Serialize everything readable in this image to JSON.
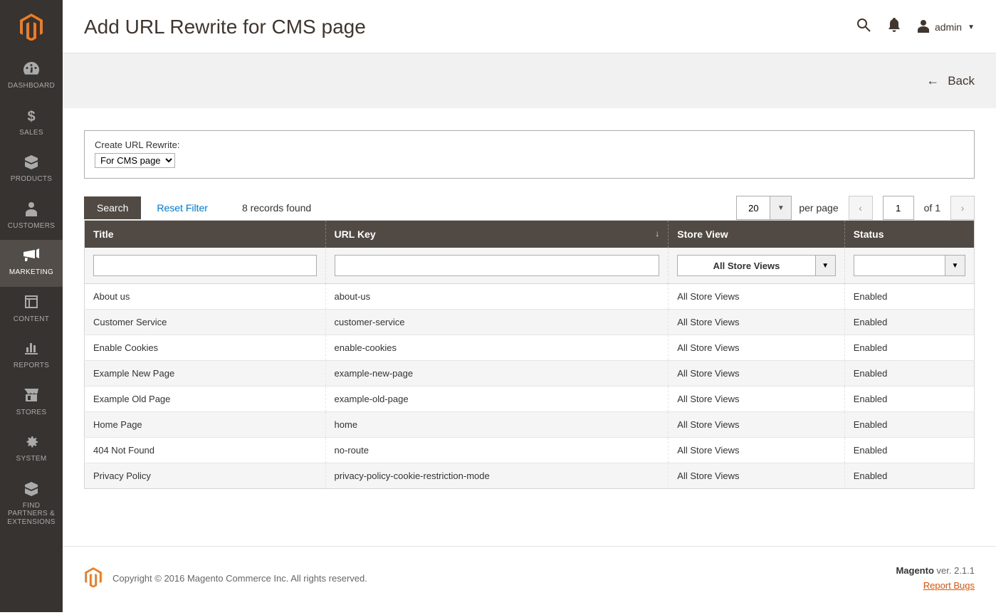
{
  "sidebar": {
    "items": [
      {
        "label": "DASHBOARD"
      },
      {
        "label": "SALES"
      },
      {
        "label": "PRODUCTS"
      },
      {
        "label": "CUSTOMERS"
      },
      {
        "label": "MARKETING"
      },
      {
        "label": "CONTENT"
      },
      {
        "label": "REPORTS"
      },
      {
        "label": "STORES"
      },
      {
        "label": "SYSTEM"
      },
      {
        "label": "FIND PARTNERS & EXTENSIONS"
      }
    ]
  },
  "header": {
    "page_title": "Add URL Rewrite for CMS page",
    "admin_label": "admin"
  },
  "actionbar": {
    "back_label": "Back"
  },
  "rewrite_box": {
    "label": "Create URL Rewrite:",
    "selected": "For CMS page"
  },
  "toolbar": {
    "search_label": "Search",
    "reset_label": "Reset Filter",
    "records_found": "8 records found",
    "perpage_value": "20",
    "perpage_label": "per page",
    "page_value": "1",
    "page_of": "of 1"
  },
  "columns": {
    "title": "Title",
    "urlkey": "URL Key",
    "storeview": "Store View",
    "status": "Status"
  },
  "filters": {
    "storeview_selected": "All Store Views"
  },
  "rows": [
    {
      "title": "About us",
      "urlkey": "about-us",
      "storeview": "All Store Views",
      "status": "Enabled"
    },
    {
      "title": "Customer Service",
      "urlkey": "customer-service",
      "storeview": "All Store Views",
      "status": "Enabled"
    },
    {
      "title": "Enable Cookies",
      "urlkey": "enable-cookies",
      "storeview": "All Store Views",
      "status": "Enabled"
    },
    {
      "title": "Example New Page",
      "urlkey": "example-new-page",
      "storeview": "All Store Views",
      "status": "Enabled"
    },
    {
      "title": "Example Old Page",
      "urlkey": "example-old-page",
      "storeview": "All Store Views",
      "status": "Enabled"
    },
    {
      "title": "Home Page",
      "urlkey": "home",
      "storeview": "All Store Views",
      "status": "Enabled"
    },
    {
      "title": "404 Not Found",
      "urlkey": "no-route",
      "storeview": "All Store Views",
      "status": "Enabled"
    },
    {
      "title": "Privacy Policy",
      "urlkey": "privacy-policy-cookie-restriction-mode",
      "storeview": "All Store Views",
      "status": "Enabled"
    }
  ],
  "footer": {
    "copyright": "Copyright © 2016 Magento Commerce Inc. All rights reserved.",
    "brand": "Magento",
    "version": " ver. 2.1.1",
    "report": "Report Bugs"
  }
}
